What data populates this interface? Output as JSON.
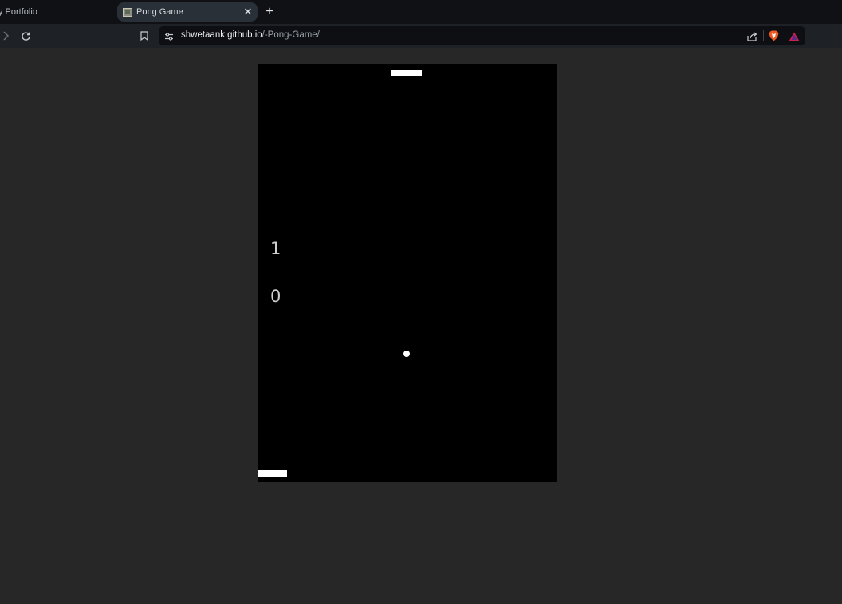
{
  "browser": {
    "tabs": [
      {
        "title": "y Portfolio",
        "active": false
      },
      {
        "title": "Pong Game",
        "active": true
      }
    ],
    "close_glyph": "✕",
    "new_tab_glyph": "+",
    "url": {
      "host": "shwetaank.github.io",
      "path": "/-Pong-Game/"
    },
    "icons": [
      "forward-icon",
      "reload-icon",
      "bookmark-icon",
      "site-settings-icon",
      "share-icon",
      "brave-shields-icon",
      "brave-rewards-icon"
    ],
    "colors": {
      "tabstrip": "#0f1114",
      "toolbar": "#1e2227",
      "urlbar": "#0d0f12",
      "page_background": "#272727"
    }
  },
  "game": {
    "background_color": "#000000",
    "paddle_color": "#ffffff",
    "ball_color": "#ffffff",
    "scores": {
      "top_player": "1",
      "bottom_player": "0"
    }
  }
}
